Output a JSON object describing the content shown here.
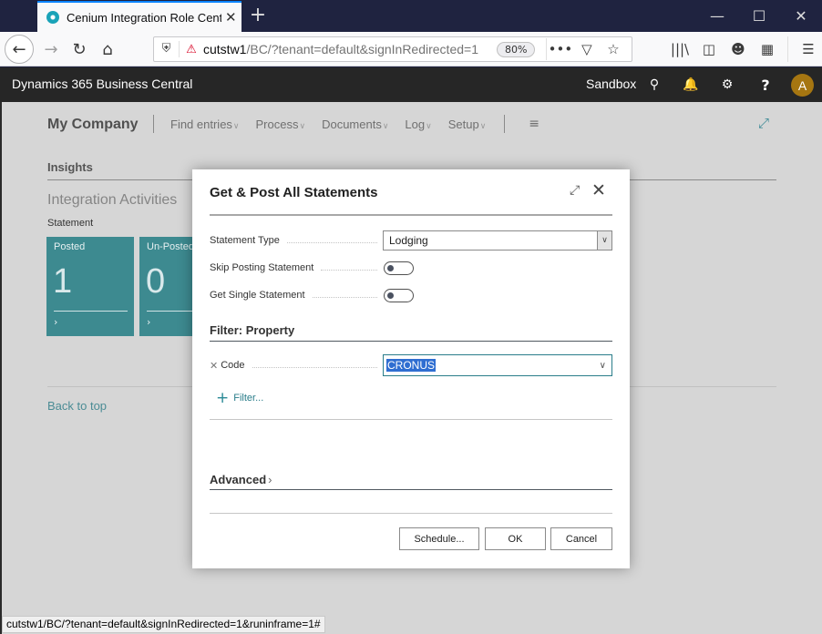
{
  "browser": {
    "tab_title": "Cenium Integration Role Center",
    "new_tab_symbol": "+",
    "url_host": "cutstw1",
    "url_path": "/BC/?tenant=default&signInRedirected=1",
    "zoom_level": "80%",
    "status_url": "cutstw1/BC/?tenant=default&signInRedirected=1&runinframe=1#"
  },
  "bc_header": {
    "brand": "Dynamics 365 Business Central",
    "environment": "Sandbox",
    "avatar_initial": "A",
    "avatar_color": "#a67611"
  },
  "page": {
    "company": "My Company",
    "actions": [
      {
        "label": "Find entries"
      },
      {
        "label": "Process"
      },
      {
        "label": "Documents"
      },
      {
        "label": "Log"
      },
      {
        "label": "Setup"
      }
    ],
    "insights_title": "Insights",
    "activities_title": "Integration Activities",
    "cue_group": "Statement",
    "tiles": [
      {
        "label": "Posted",
        "value": "1"
      },
      {
        "label": "Un-Posted",
        "value": "0"
      }
    ],
    "tile_color": "#3d8a90",
    "back_to_top": "Back to top"
  },
  "dialog": {
    "title": "Get & Post All Statements",
    "fields": {
      "statement_type": {
        "label": "Statement Type",
        "value": "Lodging"
      },
      "skip_posting": {
        "label": "Skip Posting Statement",
        "value": false
      },
      "single_statement": {
        "label": "Get Single Statement",
        "value": false
      }
    },
    "filter_section": {
      "title": "Filter: Property",
      "code_label": "Code",
      "code_value": "CRONUS",
      "add_filter_label": "Filter..."
    },
    "advanced_label": "Advanced",
    "buttons": {
      "schedule": "Schedule...",
      "ok": "OK",
      "cancel": "Cancel"
    }
  }
}
